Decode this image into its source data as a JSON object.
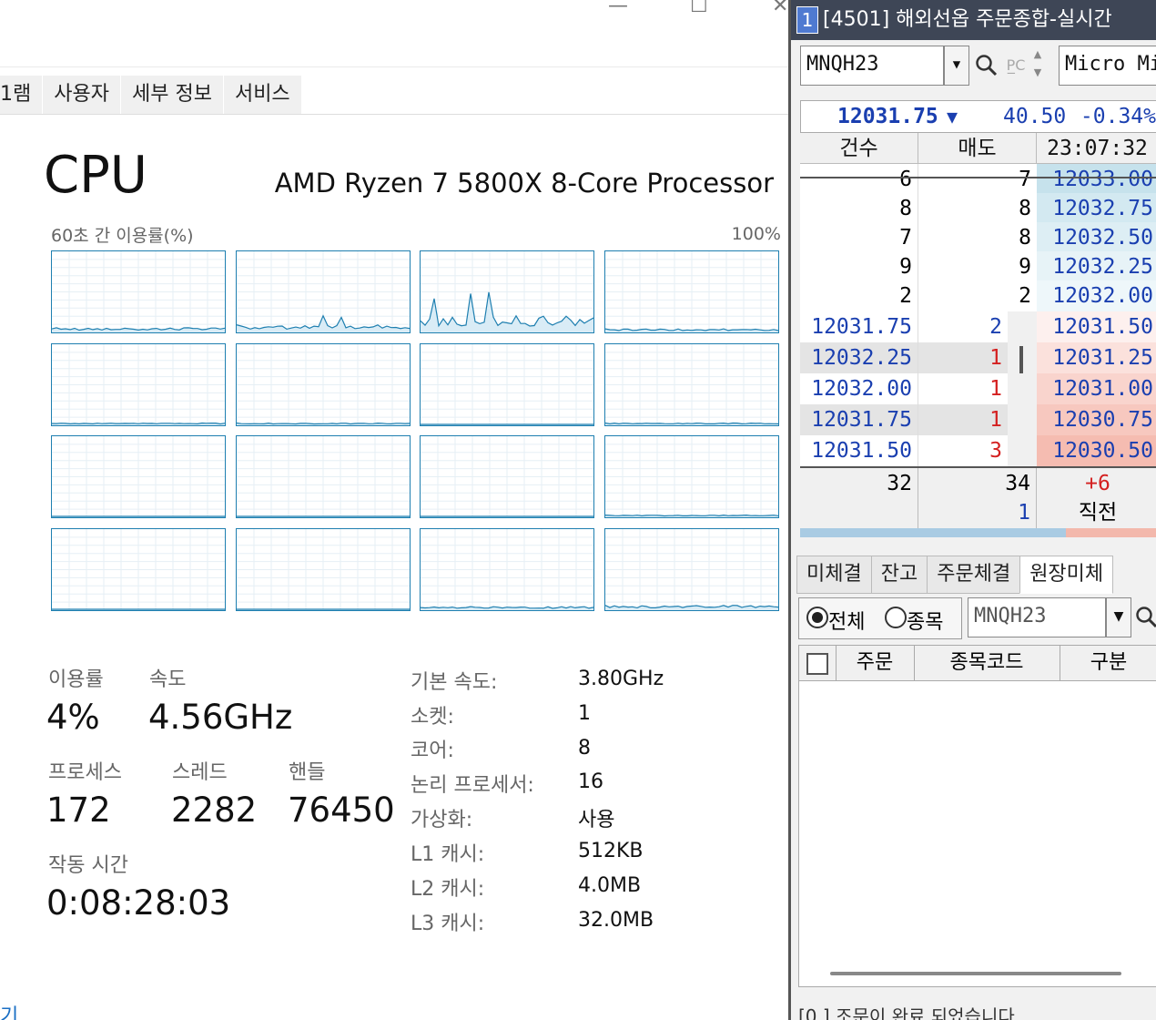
{
  "task_manager": {
    "window_controls": {
      "minimize": "—",
      "maximize": "☐",
      "close": "✕"
    },
    "tabs": [
      "1램",
      "사용자",
      "세부 정보",
      "서비스"
    ],
    "title": "CPU",
    "model": "AMD Ryzen 7 5800X 8-Core Processor",
    "graph_label_left": "60초 간 이용률(%)",
    "graph_label_right": "100%",
    "graph_color": "#1e7fb0",
    "core_usage_percent": [
      3,
      5,
      12,
      2,
      1,
      1,
      0,
      1,
      0,
      0,
      0,
      1,
      0,
      0,
      2,
      3
    ],
    "stats": {
      "util_label": "이용률",
      "util_value": "4%",
      "speed_label": "속도",
      "speed_value": "4.56GHz",
      "proc_label": "프로세스",
      "proc_value": "172",
      "thread_label": "스레드",
      "thread_value": "2282",
      "handle_label": "핸들",
      "handle_value": "76450",
      "uptime_label": "작동 시간",
      "uptime_value": "0:08:28:03"
    },
    "specs": [
      {
        "label": "기본 속도:",
        "value": "3.80GHz"
      },
      {
        "label": "소켓:",
        "value": "1"
      },
      {
        "label": "코어:",
        "value": "8"
      },
      {
        "label": "논리 프로세서:",
        "value": "16"
      },
      {
        "label": "가상화:",
        "value": "사용"
      },
      {
        "label": "L1 캐시:",
        "value": "512KB"
      },
      {
        "label": "L2 캐시:",
        "value": "4.0MB"
      },
      {
        "label": "L3 캐시:",
        "value": "32.0MB"
      }
    ],
    "bottom_text": "기"
  },
  "trading": {
    "window_number": "1",
    "title": "[4501] 해외선옵 주문종합-실시간",
    "symbol": "MNQH23",
    "product": "Micro Mi",
    "last_price": "12031.75",
    "change_arrow": "▼",
    "change": "40.50",
    "change_pct": "-0.34%",
    "header": {
      "count": "건수",
      "ask": "매도",
      "time": "23:07:32"
    },
    "asks": [
      {
        "count": "6",
        "qty": "7",
        "price": "12033.00"
      },
      {
        "count": "8",
        "qty": "8",
        "price": "12032.75"
      },
      {
        "count": "7",
        "qty": "8",
        "price": "12032.50"
      },
      {
        "count": "9",
        "qty": "9",
        "price": "12032.25"
      },
      {
        "count": "2",
        "qty": "2",
        "price": "12032.00"
      }
    ],
    "trades": [
      {
        "price": "12031.75",
        "qty": "2",
        "bid": "12031.50"
      },
      {
        "price": "12032.25",
        "qty": "1",
        "bid": "12031.25"
      },
      {
        "price": "12032.00",
        "qty": "1",
        "bid": "12031.00"
      },
      {
        "price": "12031.75",
        "qty": "1",
        "bid": "12030.75"
      },
      {
        "price": "12031.50",
        "qty": "3",
        "bid": "12030.50"
      }
    ],
    "totals": {
      "count": "32",
      "qty": "34",
      "diff": "+6"
    },
    "last_row": {
      "qty": "1",
      "label": "직전"
    },
    "subtabs": [
      "미체결",
      "잔고",
      "주문체결",
      "원장미체"
    ],
    "filter": {
      "all": "전체",
      "item": "종목",
      "symbol": "MNQH23"
    },
    "columns": [
      "주문",
      "종목코드",
      "구분"
    ],
    "status": "[0      ] 조문이 완료 되었습니다"
  }
}
